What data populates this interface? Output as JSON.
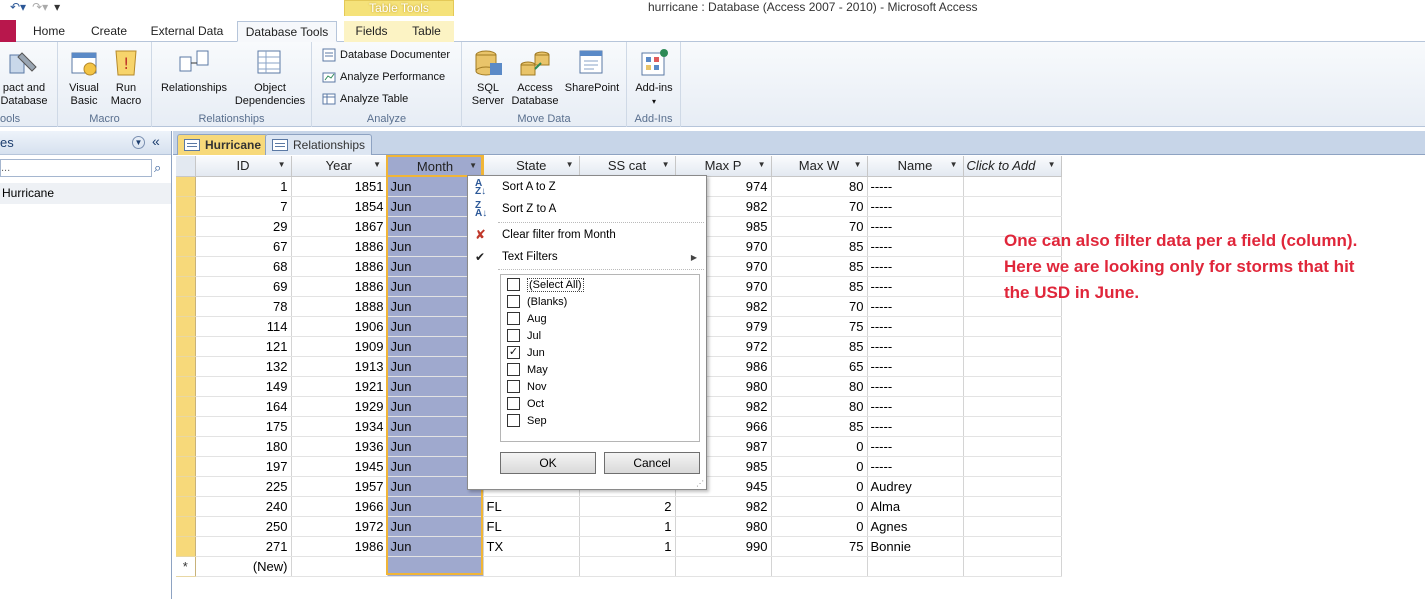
{
  "window": {
    "title": "hurricane : Database (Access 2007 - 2010)  -  Microsoft Access",
    "context_band": "Table Tools"
  },
  "ribbon_tabs": [
    {
      "label": "Home"
    },
    {
      "label": "Create"
    },
    {
      "label": "External Data"
    },
    {
      "label": "Database Tools"
    },
    {
      "label": "Fields"
    },
    {
      "label": "Table"
    }
  ],
  "ribbon": {
    "tools": {
      "compact_label_1": "pact and",
      "compact_label_2": "Database",
      "group": "ools"
    },
    "macro": {
      "visual_basic_1": "Visual",
      "visual_basic_2": "Basic",
      "run_macro_1": "Run",
      "run_macro_2": "Macro",
      "group": "Macro"
    },
    "relationships": {
      "relationships": "Relationships",
      "object_dep_1": "Object",
      "object_dep_2": "Dependencies",
      "group": "Relationships"
    },
    "analyze": {
      "documenter": "Database Documenter",
      "performance": "Analyze Performance",
      "table": "Analyze Table",
      "group": "Analyze"
    },
    "move_data": {
      "sql_1": "SQL",
      "sql_2": "Server",
      "access_1": "Access",
      "access_2": "Database",
      "sharepoint": "SharePoint",
      "group": "Move Data"
    },
    "addins": {
      "addins": "Add-ins",
      "group": "Add-Ins"
    }
  },
  "nav_pane": {
    "header": "es",
    "search_placeholder": "...",
    "item": "Hurricane"
  },
  "doc_tabs": [
    {
      "label": "Hurricane"
    },
    {
      "label": "Relationships"
    }
  ],
  "columns": [
    "ID",
    "Year",
    "Month",
    "State",
    "SS cat",
    "Max P",
    "Max W",
    "Name",
    "Click to Add"
  ],
  "rows": [
    {
      "id": "1",
      "year": "1851",
      "month": "Jun",
      "state": "",
      "sscat": "",
      "maxp": "974",
      "maxw": "80",
      "name": "-----"
    },
    {
      "id": "7",
      "year": "1854",
      "month": "Jun",
      "state": "",
      "sscat": "",
      "maxp": "982",
      "maxw": "70",
      "name": "-----"
    },
    {
      "id": "29",
      "year": "1867",
      "month": "Jun",
      "state": "",
      "sscat": "",
      "maxp": "985",
      "maxw": "70",
      "name": "-----"
    },
    {
      "id": "67",
      "year": "1886",
      "month": "Jun",
      "state": "",
      "sscat": "",
      "maxp": "970",
      "maxw": "85",
      "name": "-----"
    },
    {
      "id": "68",
      "year": "1886",
      "month": "Jun",
      "state": "",
      "sscat": "",
      "maxp": "970",
      "maxw": "85",
      "name": "-----"
    },
    {
      "id": "69",
      "year": "1886",
      "month": "Jun",
      "state": "",
      "sscat": "",
      "maxp": "970",
      "maxw": "85",
      "name": "-----"
    },
    {
      "id": "78",
      "year": "1888",
      "month": "Jun",
      "state": "",
      "sscat": "",
      "maxp": "982",
      "maxw": "70",
      "name": "-----"
    },
    {
      "id": "114",
      "year": "1906",
      "month": "Jun",
      "state": "",
      "sscat": "",
      "maxp": "979",
      "maxw": "75",
      "name": "-----"
    },
    {
      "id": "121",
      "year": "1909",
      "month": "Jun",
      "state": "",
      "sscat": "",
      "maxp": "972",
      "maxw": "85",
      "name": "-----"
    },
    {
      "id": "132",
      "year": "1913",
      "month": "Jun",
      "state": "",
      "sscat": "",
      "maxp": "986",
      "maxw": "65",
      "name": "-----"
    },
    {
      "id": "149",
      "year": "1921",
      "month": "Jun",
      "state": "",
      "sscat": "",
      "maxp": "980",
      "maxw": "80",
      "name": "-----"
    },
    {
      "id": "164",
      "year": "1929",
      "month": "Jun",
      "state": "",
      "sscat": "",
      "maxp": "982",
      "maxw": "80",
      "name": "-----"
    },
    {
      "id": "175",
      "year": "1934",
      "month": "Jun",
      "state": "",
      "sscat": "",
      "maxp": "966",
      "maxw": "85",
      "name": "-----"
    },
    {
      "id": "180",
      "year": "1936",
      "month": "Jun",
      "state": "",
      "sscat": "",
      "maxp": "987",
      "maxw": "0",
      "name": "-----"
    },
    {
      "id": "197",
      "year": "1945",
      "month": "Jun",
      "state": "",
      "sscat": "",
      "maxp": "985",
      "maxw": "0",
      "name": "-----"
    },
    {
      "id": "225",
      "year": "1957",
      "month": "Jun",
      "state": "",
      "sscat": "",
      "maxp": "945",
      "maxw": "0",
      "name": "Audrey"
    },
    {
      "id": "240",
      "year": "1966",
      "month": "Jun",
      "state": "FL",
      "sscat": "2",
      "maxp": "982",
      "maxw": "0",
      "name": "Alma"
    },
    {
      "id": "250",
      "year": "1972",
      "month": "Jun",
      "state": "FL",
      "sscat": "1",
      "maxp": "980",
      "maxw": "0",
      "name": "Agnes"
    },
    {
      "id": "271",
      "year": "1986",
      "month": "Jun",
      "state": "TX",
      "sscat": "1",
      "maxp": "990",
      "maxw": "75",
      "name": "Bonnie"
    }
  ],
  "new_row": {
    "marker": "*",
    "label": "(New)"
  },
  "filter_menu": {
    "sort_az": "Sort A to Z",
    "sort_za": "Sort Z to A",
    "clear": "Clear filter from Month",
    "text_filters": "Text Filters",
    "options": [
      {
        "label": "(Select All)",
        "checked": false
      },
      {
        "label": "(Blanks)",
        "checked": false
      },
      {
        "label": "Aug",
        "checked": false
      },
      {
        "label": "Jul",
        "checked": false
      },
      {
        "label": "Jun",
        "checked": true
      },
      {
        "label": "May",
        "checked": false
      },
      {
        "label": "Nov",
        "checked": false
      },
      {
        "label": "Oct",
        "checked": false
      },
      {
        "label": "Sep",
        "checked": false
      }
    ],
    "ok": "OK",
    "cancel": "Cancel"
  },
  "annotation": "One can also filter data per a field (column). Here we are looking only for storms that hit the USD in June.",
  "colors": {
    "accent_red": "#e0263a",
    "selected_column": "#9fa9ce",
    "active_tab": "#f7d97a"
  }
}
